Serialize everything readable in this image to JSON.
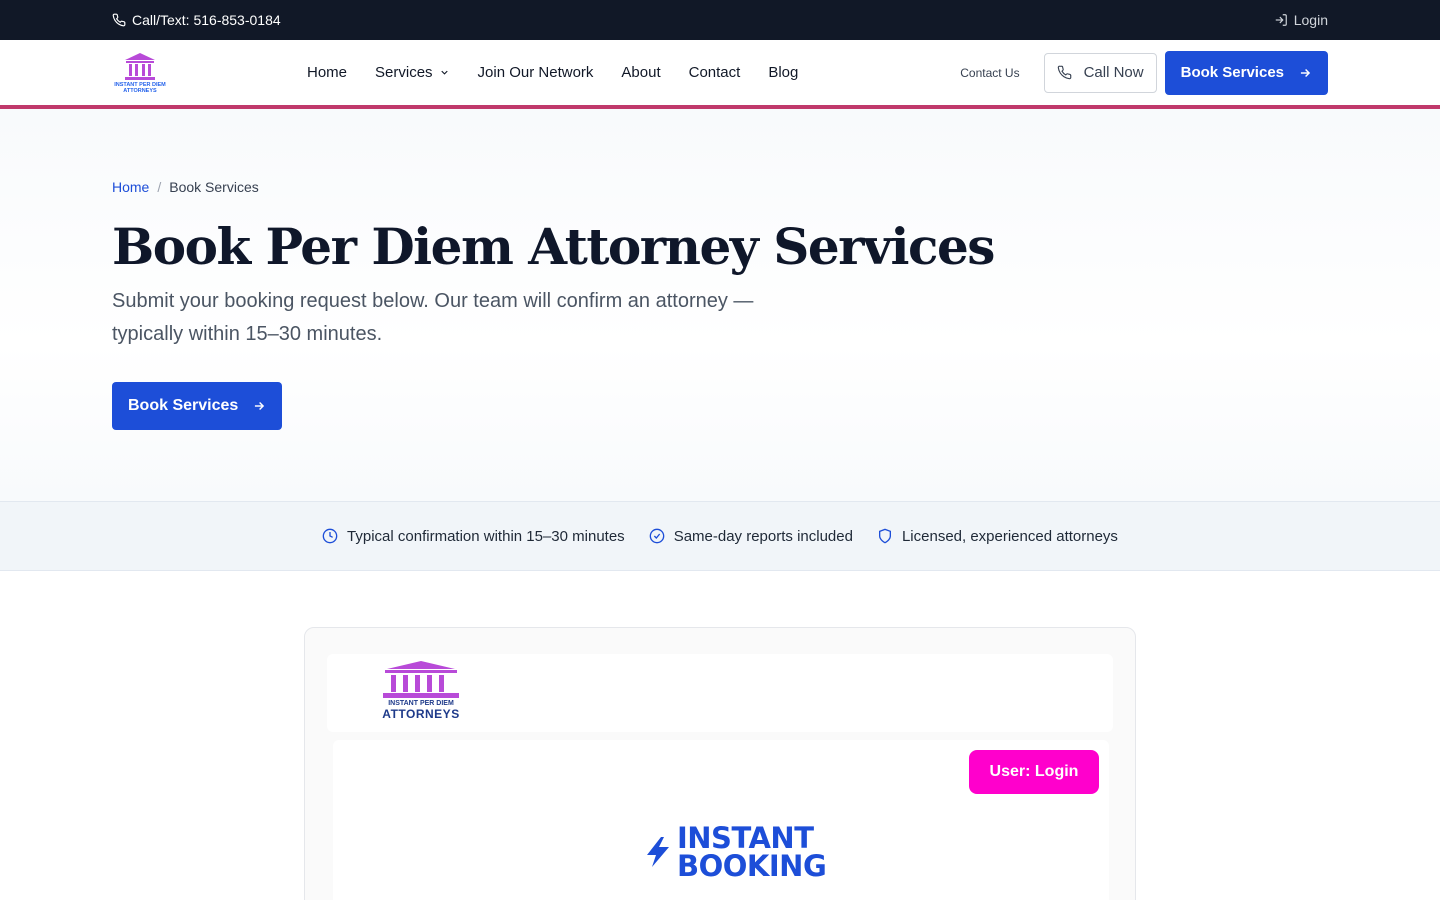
{
  "topbar": {
    "phone_text": "Call/Text: 516-853-0184",
    "login_label": "Login"
  },
  "header": {
    "logo_text_line1": "INSTANT PER DIEM",
    "logo_text_line2": "ATTORNEYS",
    "nav": [
      {
        "label": "Home"
      },
      {
        "label": "Services"
      },
      {
        "label": "Join Our Network"
      },
      {
        "label": "About"
      },
      {
        "label": "Contact"
      },
      {
        "label": "Blog"
      }
    ],
    "contact_us_label": "Contact Us",
    "call_now_label": "Call Now",
    "book_services_label": "Book Services"
  },
  "hero": {
    "breadcrumb": {
      "home": "Home",
      "separator": "/",
      "current": "Book Services"
    },
    "title": "Book Per Diem Attorney Services",
    "subtitle": "Submit your booking request below. Our team will confirm an attorney — typically within 15–30 minutes.",
    "cta_label": "Book Services"
  },
  "features": [
    {
      "label": "Typical confirmation within 15–30 minutes",
      "icon": "clock-icon"
    },
    {
      "label": "Same-day reports included",
      "icon": "check-circle-icon"
    },
    {
      "label": "Licensed, experienced attorneys",
      "icon": "shield-icon"
    }
  ],
  "booking": {
    "logo_line1": "INSTANT PER DIEM",
    "logo_line2": "ATTORNEYS",
    "user_login_label": "User: Login",
    "instant_line1": "INSTANT",
    "instant_line2": "BOOKING"
  },
  "colors": {
    "topbar_bg": "#111827",
    "primary": "#1d4ed8",
    "header_accent": "#c0396b",
    "login_pink": "#ff00cc",
    "logo_purple": "#b84ad8"
  }
}
